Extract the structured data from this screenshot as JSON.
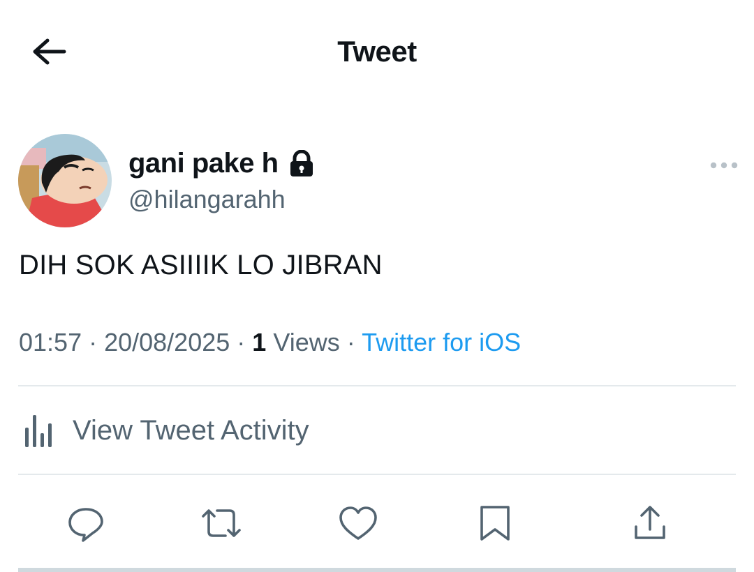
{
  "header": {
    "title": "Tweet",
    "back_icon": "arrow-left-icon"
  },
  "author": {
    "display_name": "gani pake h",
    "handle": "@hilangarahh",
    "protected_icon": "lock-icon"
  },
  "tweet": {
    "text": "DIH SOK ASIIIIK LO JIBRAN",
    "time": "01:57",
    "separator": " · ",
    "date": "20/08/2025",
    "views_count": "1",
    "views_label": "Views",
    "source": "Twitter for iOS"
  },
  "activity": {
    "label": "View Tweet Activity",
    "icon": "bar-chart-icon"
  },
  "actions": [
    {
      "name": "reply",
      "icon": "reply-icon"
    },
    {
      "name": "retweet",
      "icon": "retweet-icon"
    },
    {
      "name": "like",
      "icon": "heart-icon"
    },
    {
      "name": "bookmark",
      "icon": "bookmark-icon"
    },
    {
      "name": "share",
      "icon": "share-icon"
    }
  ],
  "colors": {
    "text": "#0f1419",
    "secondary": "#536471",
    "accent": "#1d9bf0",
    "divider": "#e4e9ec"
  }
}
